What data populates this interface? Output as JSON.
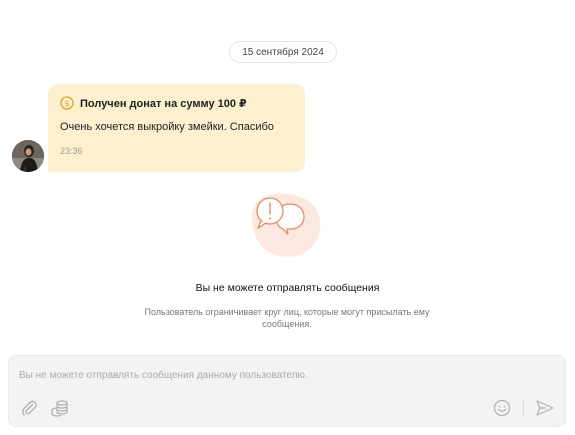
{
  "chat": {
    "date_divider": "15 сентября 2024",
    "message": {
      "donation_title": "Получен донат на сумму 100 ₽",
      "text": "Очень хочется выкройку змейки. Спасибо",
      "time": "23:36"
    }
  },
  "blocked_notice": {
    "title": "Вы не можете отправлять сообщения",
    "description": "Пользователь ограничивает круг лиц, которые могут присылать ему сообщения."
  },
  "composer": {
    "placeholder": "Вы не можете отправлять сообщения данному пользователю."
  },
  "colors": {
    "bubble_bg": "#fcf0cf",
    "coin_accent": "#e0a020",
    "illustration_accent": "#e8895e",
    "illustration_bg": "#fbe8e0"
  },
  "icons": {
    "coin": "coin-icon",
    "attach": "paperclip-icon",
    "coins": "coins-stack-icon",
    "emoji": "smiley-icon",
    "send": "send-icon",
    "illustration": "chat-bubbles-warning-icon"
  }
}
